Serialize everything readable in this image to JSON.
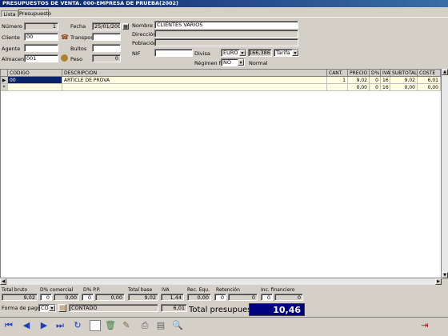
{
  "window": {
    "title": "PRESUPUESTOS DE VENTA.  000-EMPRESA DE PRUEBA(2002)"
  },
  "tabs": [
    {
      "label": "Lista"
    },
    {
      "label": "Presupuesto"
    }
  ],
  "header": {
    "numero_label": "Número",
    "numero_value": "1",
    "fecha_label": "Fecha",
    "fecha_value": "25/01/2003",
    "nombre_label": "Nombre",
    "nombre_value": "CLIENTES VARIOS",
    "direccion_label": "Dirección",
    "direccion_value": "",
    "poblacion_label": "Población",
    "poblacion_value": "",
    "cliente_label": "Cliente",
    "cliente_value": "00",
    "transporte_label": "Transporte",
    "transporte_value": "",
    "agente_label": "Agente",
    "agente_value": "",
    "bultos_label": "Bultos",
    "bultos_value": "",
    "almacen_label": "Almacen",
    "almacen_value": "001",
    "peso_label": "Peso",
    "peso_value": "0",
    "nif_label": "NIF",
    "nif_value": "",
    "divisa_label": "Divisa",
    "divisa_value": "EURO",
    "divisa_rate": "166,386",
    "tarifa_value": "Tarifa 1",
    "regimen_label": "Régimen F.",
    "regimen_value": "NO",
    "regimen_text": "Normal"
  },
  "grid": {
    "columns": [
      "CODIGO",
      "DESCRIPCION",
      "CANT.",
      "PRECIO",
      "D%",
      "IVA",
      "SUBTOTAL",
      "COSTE"
    ],
    "rows": [
      {
        "codigo": "00",
        "descripcion": "ARTICLE DE PROVA",
        "cant": "1",
        "precio": "9,02",
        "dto": "0",
        "iva": "16",
        "subtotal": "9,02",
        "coste": "6,01"
      },
      {
        "codigo": "",
        "descripcion": "",
        "cant": "",
        "precio": "0,00",
        "dto": "0",
        "iva": "16",
        "subtotal": "0,00",
        "coste": "0,00"
      }
    ]
  },
  "totals": {
    "bruto_label": "Total bruto",
    "bruto_value": "9,02",
    "dcomercial_label": "D% comercial",
    "dcomercial_pct": "0",
    "dcomercial_value": "0,00",
    "dpp_label": "D% P.P.",
    "dpp_pct": "0",
    "dpp_value": "0,00",
    "base_label": "Total base",
    "base_value": "9,02",
    "iva_label": "IVA",
    "iva_value": "1,44",
    "recequ_label": "Rec. Equ.",
    "recequ_value": "0,00",
    "retencion_label": "Retención",
    "retencion_pct": "0",
    "retencion_value": "0",
    "incfin_label": "Inc. financiero",
    "incfin_pct": "0",
    "incfin_value": "0",
    "formapago_label": "Forma de pago",
    "formapago_code": "CO",
    "formapago_text": "CONTADO",
    "coste_value": "6,01",
    "presupuesto_label": "Total presupuesto",
    "presupuesto_value": "10,46"
  },
  "toolbar": {
    "icons": [
      "first-record-icon",
      "prev-record-icon",
      "next-record-icon",
      "last-record-icon",
      "refresh-icon",
      "new-doc-icon",
      "delete-icon",
      "edit-icon",
      "print-icon",
      "preview-icon",
      "search-icon",
      "exit-icon"
    ]
  },
  "colors": {
    "title_bar": "#0a246a",
    "total_box": "#000080",
    "row_highlight": "#fffde0",
    "selected_cell": "#0a246a"
  }
}
